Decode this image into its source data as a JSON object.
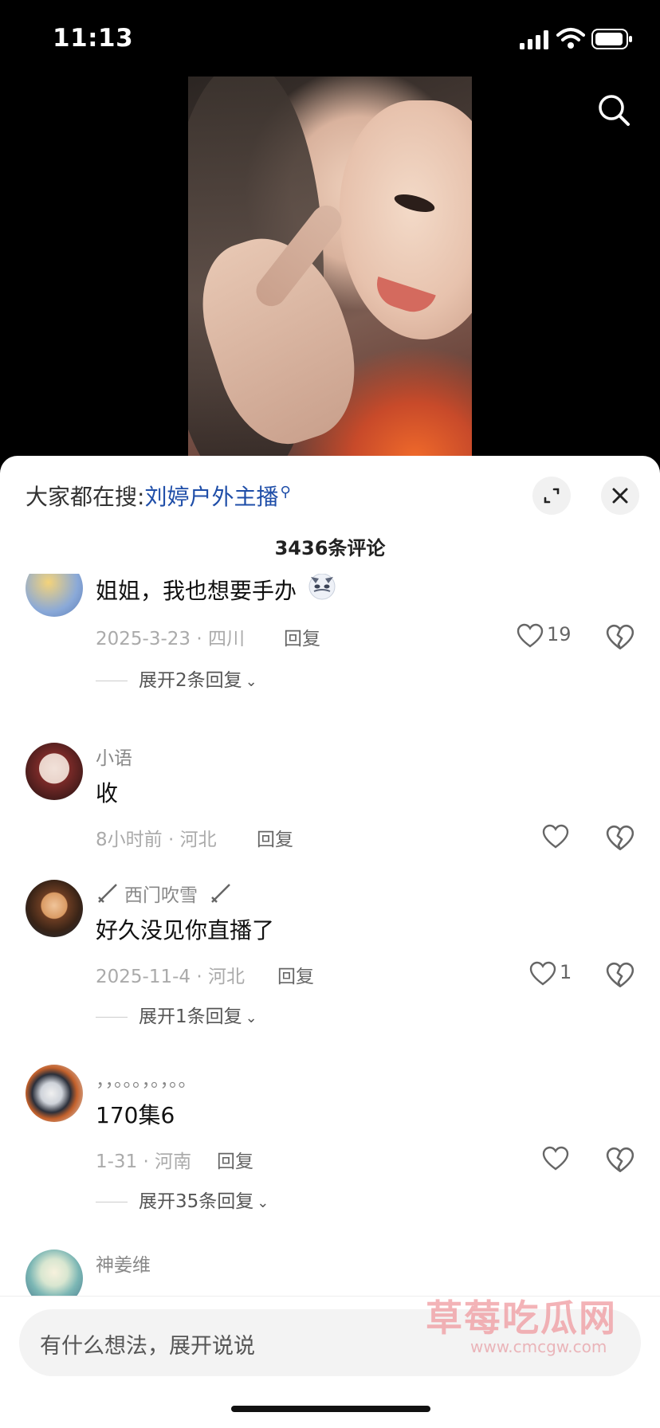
{
  "status_bar": {
    "time": "11:13"
  },
  "sheet": {
    "suggest_label": "大家都在搜:",
    "suggest_keyword": "刘婷户外主播",
    "comment_count": "3436条评论"
  },
  "comments": [
    {
      "user": "",
      "text": "姐姐，我也想要手办",
      "date_location": "2025-3-23 · 四川",
      "reply": "回复",
      "likes": "19",
      "expand": "展开2条回复"
    },
    {
      "user": "小语",
      "text": "收",
      "date_location": "8小时前 · 河北",
      "reply": "回复",
      "likes": "",
      "expand": ""
    },
    {
      "user": "西门吹雪",
      "text": "好久没见你直播了",
      "date_location": "2025-11-4 · 河北",
      "reply": "回复",
      "likes": "1",
      "expand": "展开1条回复"
    },
    {
      "user": "，，。。。，。，。。",
      "text": "170集6",
      "date_location": "1-31 · 河南",
      "reply": "回复",
      "likes": "",
      "expand": "展开35条回复"
    },
    {
      "user": "神姜维",
      "text": "",
      "date_location": "",
      "reply": "",
      "likes": "",
      "expand": ""
    }
  ],
  "input": {
    "placeholder": "有什么想法，展开说说"
  },
  "watermark": {
    "brand": "草莓吃瓜网",
    "url": "www.cmcgw.com"
  }
}
